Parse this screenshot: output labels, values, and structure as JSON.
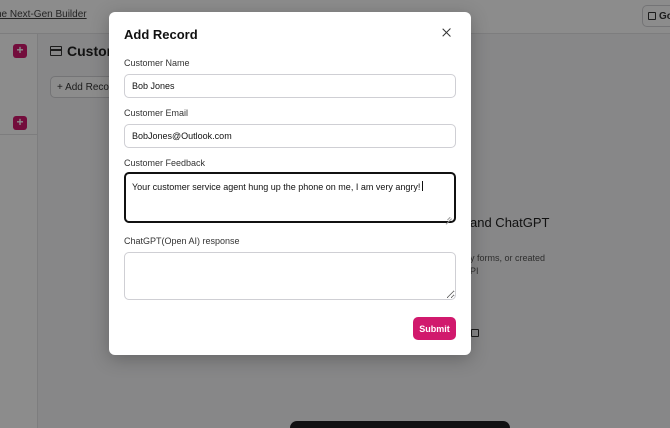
{
  "background": {
    "brand": "he Next-Gen Builder",
    "go_button": "Go",
    "page_title": "Custon",
    "add_record_button": "+ Add Recor",
    "heading_fragment": "and ChatGPT",
    "text_line_1": "y forms, or created",
    "text_line_2": "PI"
  },
  "modal": {
    "title": "Add Record",
    "fields": [
      {
        "label": "Customer Name",
        "value": "Bob Jones"
      },
      {
        "label": "Customer Email",
        "value": "BobJones@Outlook.com"
      },
      {
        "label": "Customer Feedback",
        "value": "Your customer service agent hung up the phone on me, I am very angry!"
      },
      {
        "label": "ChatGPT(Open AI) response",
        "value": ""
      }
    ],
    "submit_label": "Submit"
  },
  "colors": {
    "accent": "#d1196d",
    "overlay": "rgba(0,0,0,0.45)"
  }
}
